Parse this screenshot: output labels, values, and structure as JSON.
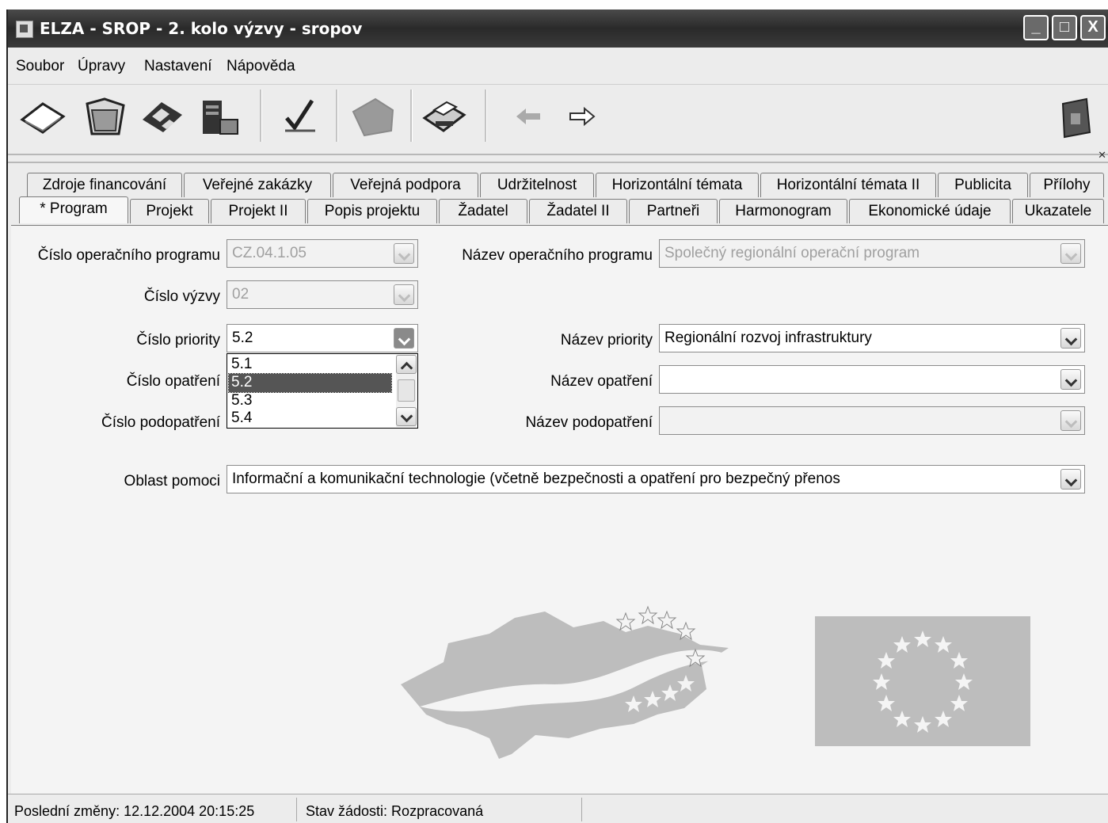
{
  "window": {
    "title": "ELZA - SROP - 2. kolo výzvy - sropov",
    "minimize": "_",
    "maximize": "□",
    "close": "X"
  },
  "menu": {
    "items": [
      "Soubor",
      "Úpravy",
      "Nastavení",
      "Nápověda"
    ]
  },
  "toolbar": {
    "icons": [
      "new-document-icon",
      "open-folder-icon",
      "save-disk-icon",
      "server-export-icon",
      "check-icon",
      "submit-envelope-icon",
      "print-icon",
      "back-arrow-icon",
      "forward-arrow-icon",
      "help-book-icon"
    ]
  },
  "tabs": {
    "row1": [
      "Zdroje financování",
      "Veřejné zakázky",
      "Veřejná podpora",
      "Udržitelnost",
      "Horizontální témata",
      "Horizontální témata II",
      "Publicita",
      "Přílohy"
    ],
    "row2": [
      "* Program",
      "Projekt",
      "Projekt II",
      "Popis projektu",
      "Žadatel",
      "Žadatel II",
      "Partneři",
      "Harmonogram",
      "Ekonomické údaje",
      "Ukazatele"
    ]
  },
  "form": {
    "cislo_op_label": "Číslo operačního programu",
    "cislo_op_value": "CZ.04.1.05",
    "nazev_op_label": "Název operačního programu",
    "nazev_op_value": "Společný regionální operační program",
    "cislo_vyzvy_label": "Číslo výzvy",
    "cislo_vyzvy_value": "02",
    "cislo_priority_label": "Číslo priority",
    "cislo_priority_value": "5.2",
    "nazev_priority_label": "Název priority",
    "nazev_priority_value": "Regionální rozvoj infrastruktury",
    "cislo_opatreni_label": "Číslo opatření",
    "nazev_opatreni_label": "Název opatření",
    "cislo_podopatreni_label": "Číslo podopatření",
    "nazev_podopatreni_label": "Název podopatření",
    "oblast_pomoci_label": "Oblast pomoci",
    "oblast_pomoci_value": "Informační a komunikační technologie (včetně bezpečnosti a opatření pro bezpečný přenos"
  },
  "priority_dropdown": {
    "options": [
      "5.1",
      "5.2",
      "5.3",
      "5.4"
    ],
    "selected": "5.2"
  },
  "status": {
    "last_change": "Poslední změny: 12.12.2004 20:15:25",
    "state": "Stav žádosti: Rozpracovaná"
  },
  "colors": {
    "logo_gray": "#bdbdbd",
    "selection": "#555555"
  }
}
